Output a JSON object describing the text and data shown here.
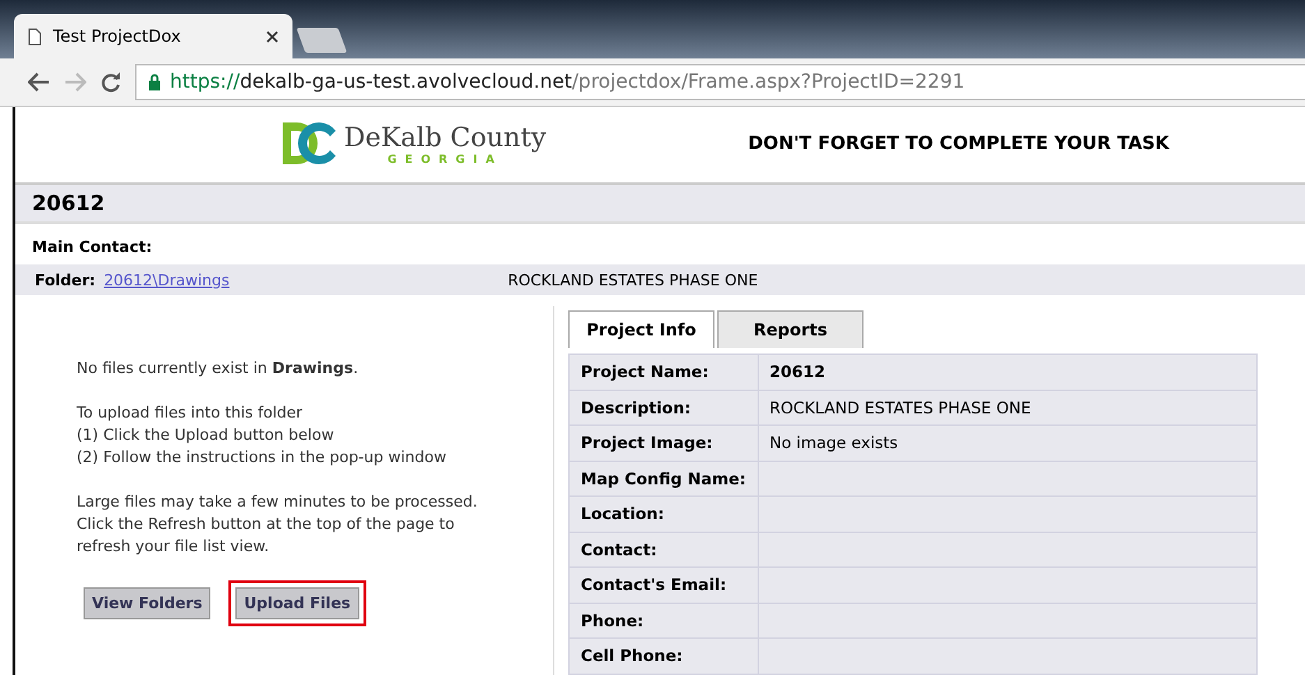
{
  "browser": {
    "tab_title": "Test ProjectDox",
    "url": {
      "scheme": "https://",
      "host": "dekalb-ga-us-test.avolvecloud.net",
      "path": "/projectdox/Frame.aspx?ProjectID=2291"
    }
  },
  "header": {
    "logo_name": "DeKalb County",
    "logo_sub": "GEORGIA",
    "notice": "DON'T FORGET TO COMPLETE YOUR TASK"
  },
  "project_title": "20612",
  "main_contact": {
    "label": "Main Contact:"
  },
  "folder": {
    "label": "Folder:",
    "link": "20612\\Drawings",
    "description": "ROCKLAND ESTATES PHASE ONE"
  },
  "message": {
    "paragraphs": [
      [
        "No files currently exist in **Drawings**."
      ],
      [
        "To upload files into this folder",
        "(1) Click the Upload button below",
        "(2) Follow the instructions in the pop-up window"
      ],
      [
        "Large files may take a few minutes to be processed.",
        "Click the Refresh button at the top of the page to",
        "refresh your file list view."
      ]
    ]
  },
  "buttons": [
    {
      "label": "View Folders",
      "highlighted": false
    },
    {
      "label": "Upload Files",
      "highlighted": true
    }
  ],
  "tabs": [
    {
      "label": "Project Info",
      "selected": true
    },
    {
      "label": "Reports",
      "selected": false
    }
  ],
  "info_rows": [
    {
      "label": "Project Name:",
      "value": "20612",
      "bold": true
    },
    {
      "label": "Description:",
      "value": "ROCKLAND ESTATES PHASE ONE",
      "bold": false
    },
    {
      "label": "Project Image:",
      "value": "No image exists",
      "bold": false
    },
    {
      "label": "Map Config Name:"
    },
    {
      "label": "Location:"
    },
    {
      "label": "Contact:"
    },
    {
      "label": "Contact's Email:"
    },
    {
      "label": "Phone:"
    },
    {
      "label": "Cell Phone:"
    }
  ]
}
